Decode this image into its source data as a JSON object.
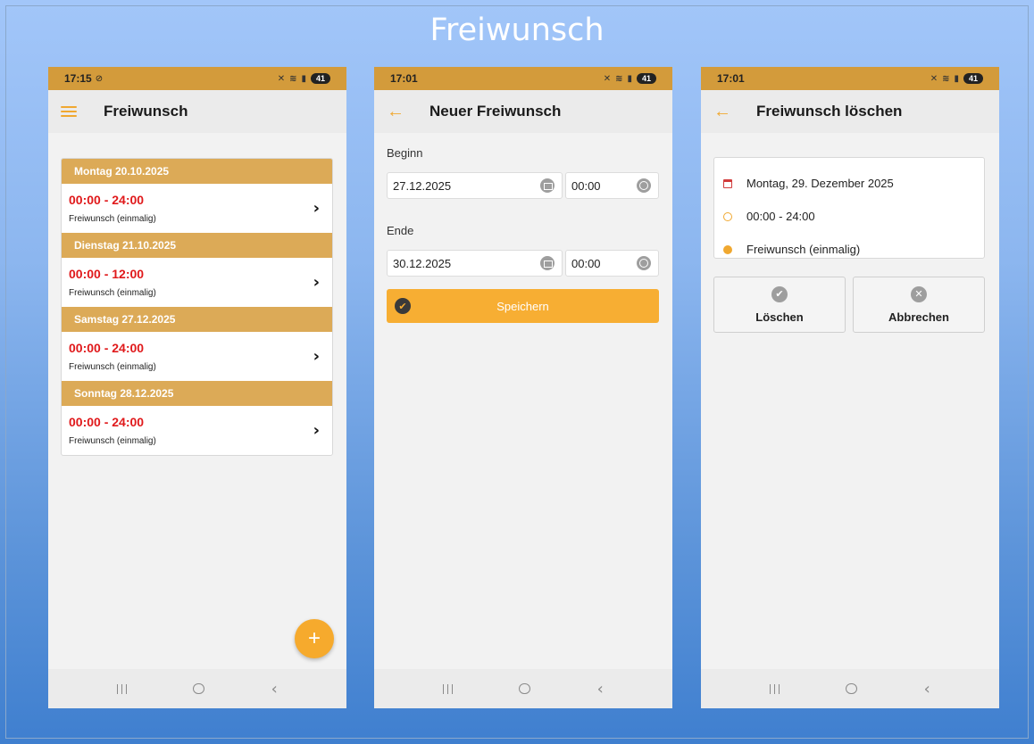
{
  "page_title": "Freiwunsch",
  "screen1": {
    "status_time": "17:15",
    "status_extra": "⊘",
    "battery": "41",
    "title": "Freiwunsch",
    "days": [
      {
        "header": "Montag 20.10.2025",
        "time": "00:00 - 24:00",
        "type": "Freiwunsch (einmalig)"
      },
      {
        "header": "Dienstag 21.10.2025",
        "time": "00:00 - 12:00",
        "type": "Freiwunsch (einmalig)"
      },
      {
        "header": "Samstag 27.12.2025",
        "time": "00:00 - 24:00",
        "type": "Freiwunsch (einmalig)"
      },
      {
        "header": "Sonntag 28.12.2025",
        "time": "00:00 - 24:00",
        "type": "Freiwunsch (einmalig)"
      }
    ],
    "fab": "+"
  },
  "screen2": {
    "status_time": "17:01",
    "battery": "41",
    "title": "Neuer Freiwunsch",
    "begin_label": "Beginn",
    "begin_date": "27.12.2025",
    "begin_time": "00:00",
    "end_label": "Ende",
    "end_date": "30.12.2025",
    "end_time": "00:00",
    "save_label": "Speichern"
  },
  "screen3": {
    "status_time": "17:01",
    "battery": "41",
    "title": "Freiwunsch löschen",
    "date": "Montag, 29. Dezember 2025",
    "time": "00:00 - 24:00",
    "type": "Freiwunsch (einmalig)",
    "delete_label": "Löschen",
    "cancel_label": "Abbrechen"
  },
  "colors": {
    "accent": "#f7ae33",
    "status_bar": "#d39b3b",
    "day_header": "#dcaa57",
    "time_red": "#e0191b"
  },
  "icons": [
    "menu-icon",
    "back-arrow-icon",
    "chevron-right-icon",
    "plus-icon",
    "calendar-icon",
    "clock-icon",
    "check-icon",
    "x-icon",
    "info-icon"
  ]
}
